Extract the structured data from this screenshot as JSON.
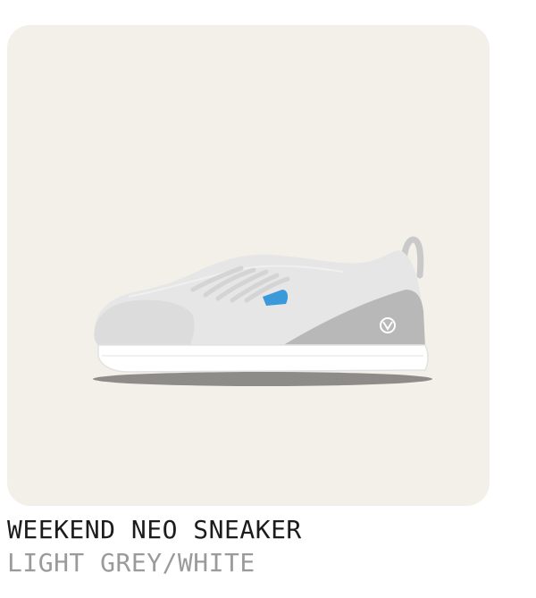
{
  "product": {
    "name": "WEEKEND NEO SNEAKER",
    "color": "LIGHT GREY/WHITE"
  },
  "colors": {
    "card_background": "#f2f0e8",
    "upper": "#e6e6e6",
    "sole": "#ffffff",
    "heel_panel": "#b8b8b8",
    "accent_tab": "#3a9ad9",
    "name_text": "#1c1c1c",
    "color_text": "#9a9a9a"
  },
  "image": {
    "icon": "sneaker-image"
  }
}
